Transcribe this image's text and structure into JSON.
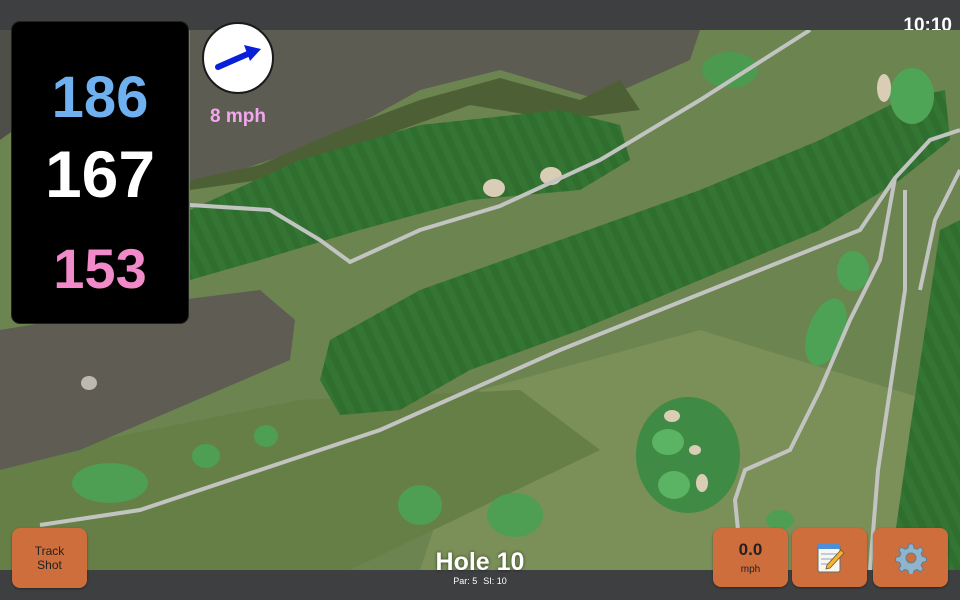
{
  "status": {
    "time": "10:10"
  },
  "distances": {
    "back": "186",
    "middle": "167",
    "front": "153"
  },
  "wind": {
    "speed": "8 mph",
    "icon": "wind-arrow-icon",
    "arrow_color": "#0a1fd8"
  },
  "hole": {
    "title": "Hole 10",
    "par": "Par: 5",
    "si": "SI: 10"
  },
  "buttons": {
    "track_shot": "Track Shot",
    "speed_value": "0.0",
    "speed_unit": "mph",
    "notes_icon": "notepad-icon",
    "settings_icon": "gear-icon"
  },
  "colors": {
    "back": "#6fb1f0",
    "middle": "#ffffff",
    "front": "#f08ac9",
    "button": "#cd6e3c",
    "wind_text": "#f2a7ef"
  }
}
